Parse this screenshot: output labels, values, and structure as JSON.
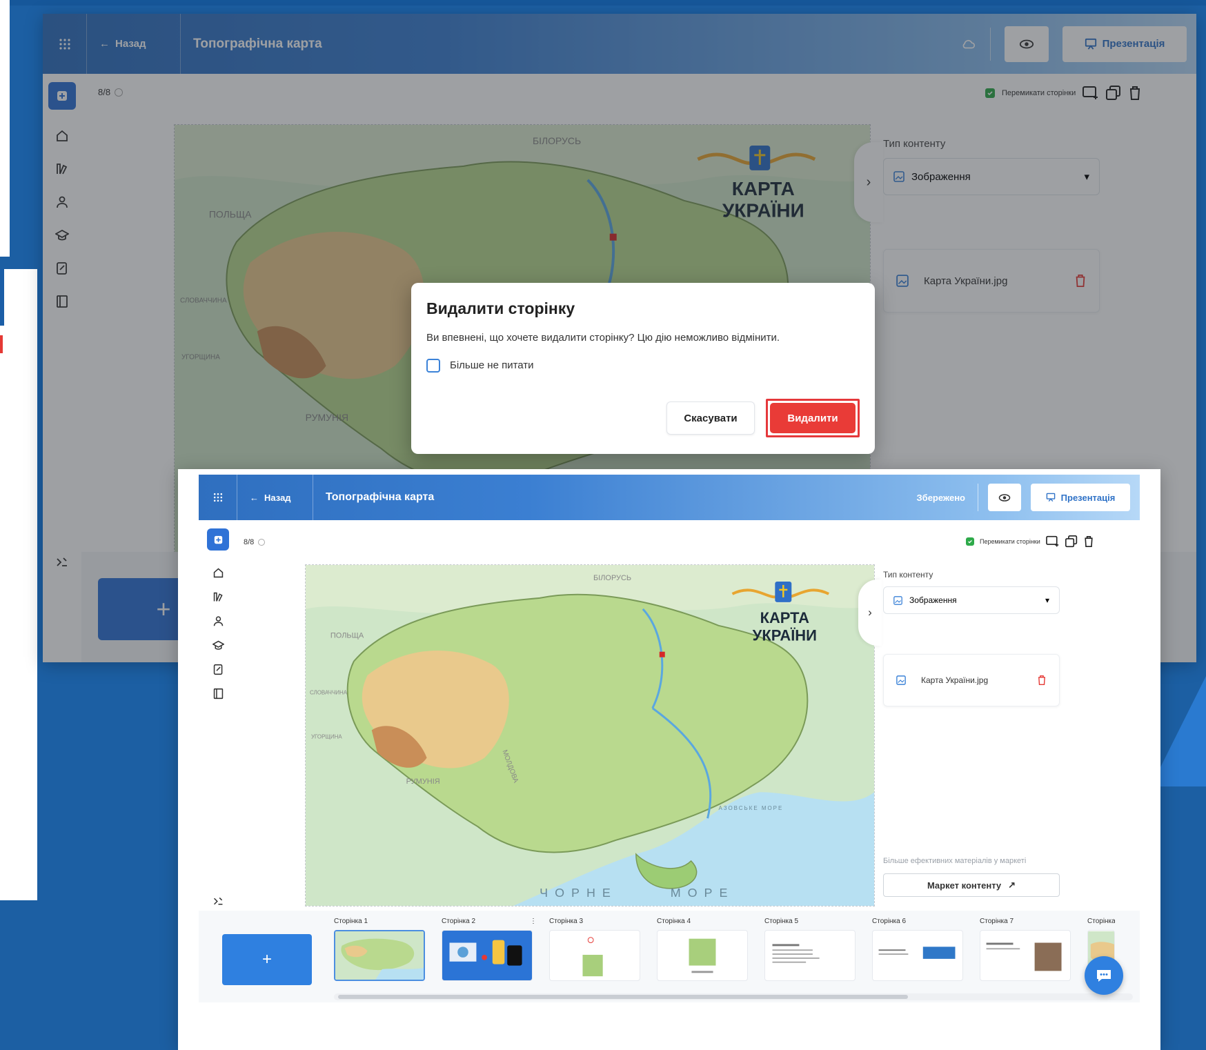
{
  "colors": {
    "primary": "#2f72d6",
    "danger": "#e93b37",
    "success": "#2eaa4a",
    "page_bg": "#1c5fa3"
  },
  "back_screen": {
    "header": {
      "back_label": "Назад",
      "title": "Топографічна карта",
      "presentation_label": "Презентація"
    },
    "page_counter": "8/8",
    "toolbar": {
      "switch_pages_label": "Перемикати сторінки"
    },
    "content_type": {
      "label": "Тип контенту",
      "value": "Зображення"
    },
    "file": {
      "name": "Карта України.jpg"
    },
    "add_page_label": "+"
  },
  "dialog": {
    "title": "Видалити сторінку",
    "message": "Ви впевнені, що хочете видалити сторінку? Цю дію неможливо відмінити.",
    "dont_ask_label": "Більше не питати",
    "cancel_label": "Скасувати",
    "delete_label": "Видалити"
  },
  "front_screen": {
    "header": {
      "back_label": "Назад",
      "title": "Топографічна карта",
      "status": "Збережено",
      "presentation_label": "Презентація"
    },
    "page_counter": "8/8",
    "toolbar": {
      "switch_pages_label": "Перемикати сторінки"
    },
    "content_type": {
      "label": "Тип контенту",
      "value": "Зображення"
    },
    "file": {
      "name": "Карта України.jpg"
    },
    "market": {
      "hint": "Більше ефективних матеріалів у маркеті",
      "button_label": "Маркет контенту"
    },
    "add_page_label": "+",
    "pages": [
      {
        "label": "Сторінка 1"
      },
      {
        "label": "Сторінка 2"
      },
      {
        "label": "Сторінка 3"
      },
      {
        "label": "Сторінка 4"
      },
      {
        "label": "Сторінка 5"
      },
      {
        "label": "Сторінка 6"
      },
      {
        "label": "Сторінка 7"
      },
      {
        "label": "Сторінка"
      }
    ]
  },
  "map": {
    "title_line1": "КАРТА",
    "title_line2": "УКРАЇНИ",
    "countries": {
      "belarus": "БІЛОРУСЬ",
      "poland": "ПОЛЬЩА",
      "slovakia": "СЛОВАЧЧИНА",
      "hungary": "УГОРЩИНА",
      "romania": "РУМУНІЯ",
      "moldova": "МОЛДОВА"
    },
    "seas": {
      "black_sea_1": "ЧОРНЕ",
      "black_sea_2": "МОРЕ",
      "azov": "АЗОВСЬКЕ МОРЕ"
    }
  }
}
